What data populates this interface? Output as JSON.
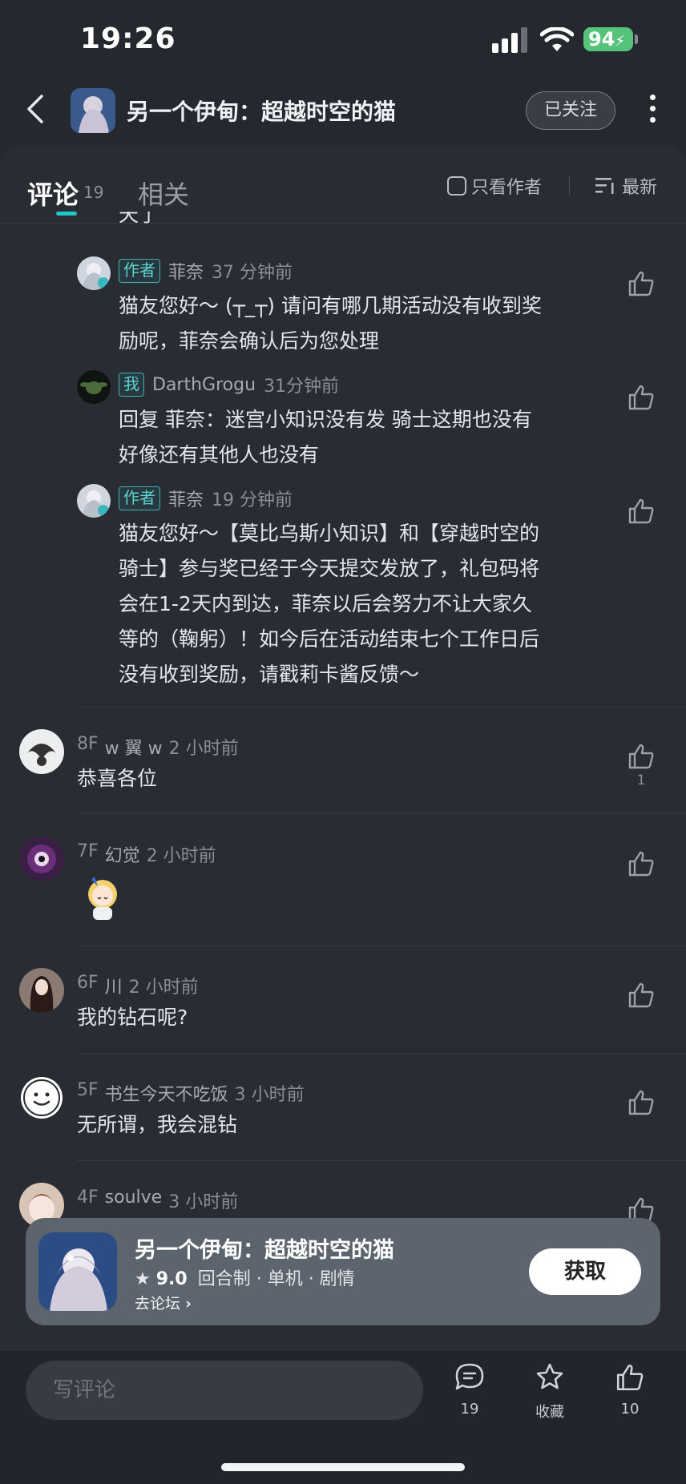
{
  "status_bar": {
    "time": "19:26",
    "battery": "94"
  },
  "header": {
    "title": "另一个伊甸：超越时空的猫",
    "follow_label": "已关注"
  },
  "tabs": {
    "comments_label": "评论",
    "comments_count": "19",
    "related_label": "相关",
    "only_author_label": "只看作者",
    "sort_label": "最新"
  },
  "truncated_text": "天了",
  "replies": [
    {
      "badge": "作者",
      "name": "菲奈",
      "time": "37 分钟前",
      "lines": [
        "猫友您好～ (┬_┬) 请问有哪几期活动没有收到奖",
        "励呢，菲奈会确认后为您处理"
      ]
    },
    {
      "badge": "我",
      "name": "DarthGrogu",
      "time": "31分钟前",
      "lines": [
        "回复 菲奈：迷宫小知识没有发 骑士这期也没有",
        "好像还有其他人也没有"
      ]
    },
    {
      "badge": "作者",
      "name": "菲奈",
      "time": "19 分钟前",
      "lines": [
        "猫友您好～【莫比乌斯小知识】和【穿越时空的",
        "骑士】参与奖已经于今天提交发放了，礼包码将",
        "会在1-2天内到达，菲奈以后会努力不让大家久",
        "等的（鞠躬）！如今后在活动结束七个工作日后",
        "没有收到奖励，请戳莉卡酱反馈～"
      ]
    }
  ],
  "comments": [
    {
      "floor": "8F",
      "name": "w 翼 w",
      "time": "2 小时前",
      "text": "恭喜各位",
      "likes": "1"
    },
    {
      "floor": "7F",
      "name": "幻觉",
      "time": "2 小时前",
      "text": "",
      "likes": ""
    },
    {
      "floor": "6F",
      "name": "川",
      "time": "2 小时前",
      "text": "我的钻石呢?",
      "likes": ""
    },
    {
      "floor": "5F",
      "name": "书生今天不吃饭",
      "time": "3 小时前",
      "text": "无所谓，我会混钻",
      "likes": ""
    },
    {
      "floor": "4F",
      "name": "soulve",
      "time": "3 小时前",
      "text": "",
      "likes": ""
    }
  ],
  "game_card": {
    "title": "另一个伊甸：超越时空的猫",
    "rating": "9.0",
    "tags": "回合制 · 单机 · 剧情",
    "forum_link": "去论坛",
    "get_label": "获取"
  },
  "bottom_bar": {
    "input_placeholder": "写评论",
    "comment_count": "19",
    "favorite_label": "收藏",
    "like_count": "10"
  },
  "colors": {
    "accent": "#1ec8c8",
    "background": "#262830",
    "card": "#5c656d"
  }
}
